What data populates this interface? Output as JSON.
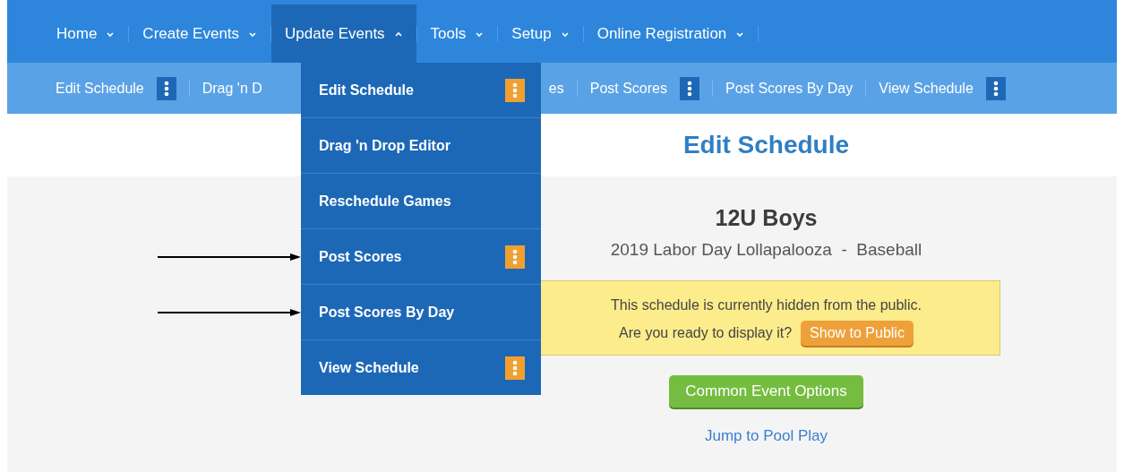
{
  "top_nav": [
    {
      "label": "Home",
      "expanded": false,
      "selected": false
    },
    {
      "label": "Create Events",
      "expanded": false,
      "selected": false
    },
    {
      "label": "Update Events",
      "expanded": true,
      "selected": true
    },
    {
      "label": "Tools",
      "expanded": false,
      "selected": false
    },
    {
      "label": "Setup",
      "expanded": false,
      "selected": false
    },
    {
      "label": "Online Registration",
      "expanded": false,
      "selected": false
    }
  ],
  "sub_nav": [
    {
      "label": "Edit Schedule",
      "has_menu": true
    },
    {
      "label": "Drag 'n D",
      "has_menu": false
    },
    {
      "label": "es",
      "has_menu": false
    },
    {
      "label": "Post Scores",
      "has_menu": true
    },
    {
      "label": "Post Scores By Day",
      "has_menu": false
    },
    {
      "label": "View Schedule",
      "has_menu": true
    }
  ],
  "dropdown": [
    {
      "label": "Edit Schedule",
      "has_menu": true,
      "pointed_at": false
    },
    {
      "label": "Drag 'n Drop Editor",
      "has_menu": false,
      "pointed_at": false
    },
    {
      "label": "Reschedule Games",
      "has_menu": false,
      "pointed_at": false
    },
    {
      "label": "Post Scores",
      "has_menu": true,
      "pointed_at": true
    },
    {
      "label": "Post Scores By Day",
      "has_menu": false,
      "pointed_at": true
    },
    {
      "label": "View Schedule",
      "has_menu": true,
      "pointed_at": false
    }
  ],
  "page_title": "Edit Schedule",
  "division": "12U Boys",
  "event": "2019 Labor Day Lollapalooza  -  Baseball",
  "notice": {
    "message": "This schedule is currently hidden from the public.",
    "question": "Are you ready to display it?",
    "button": "Show to Public"
  },
  "options_button": "Common Event Options",
  "link": "Jump to Pool Play"
}
